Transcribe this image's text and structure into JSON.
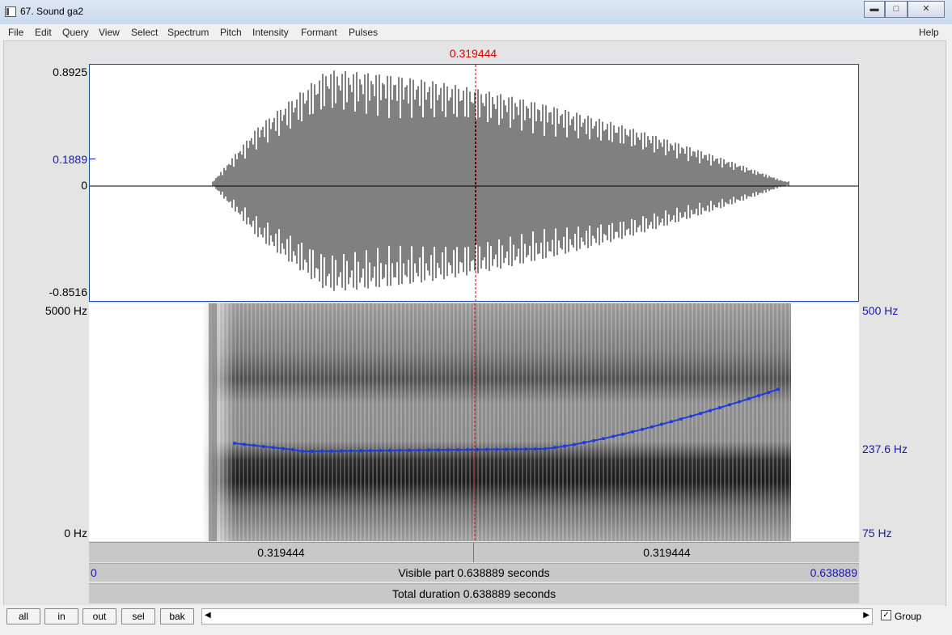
{
  "window": {
    "title": "67. Sound ga2",
    "minimize_icon": "minimize-icon",
    "maximize_icon": "maximize-icon",
    "close_icon": "close-icon"
  },
  "menu": [
    "File",
    "Edit",
    "Query",
    "View",
    "Select",
    "Spectrum",
    "Pitch",
    "Intensity",
    "Formant",
    "Pulses"
  ],
  "help": "Help",
  "cursor_time": "0.319444",
  "waveform": {
    "y_max": "0.8925",
    "y_cursor": "0.1889",
    "y_zero": "0",
    "y_min": "-0.8516"
  },
  "spectrogram": {
    "y_max": "5000 Hz",
    "y_min": "0 Hz",
    "pitch_top": "500 Hz",
    "pitch_mid": "237.6 Hz",
    "pitch_bottom": "75 Hz",
    "pitch_color": "#1f3cd8"
  },
  "time_bar": {
    "left": "0.319444",
    "right": "0.319444"
  },
  "visible": {
    "start": "0",
    "label": "Visible part 0.638889 seconds",
    "end": "0.638889"
  },
  "total": "Total duration 0.638889 seconds",
  "buttons": {
    "all": "all",
    "in": "in",
    "out": "out",
    "sel": "sel",
    "bak": "bak"
  },
  "group_label": "Group",
  "group_checked": true
}
